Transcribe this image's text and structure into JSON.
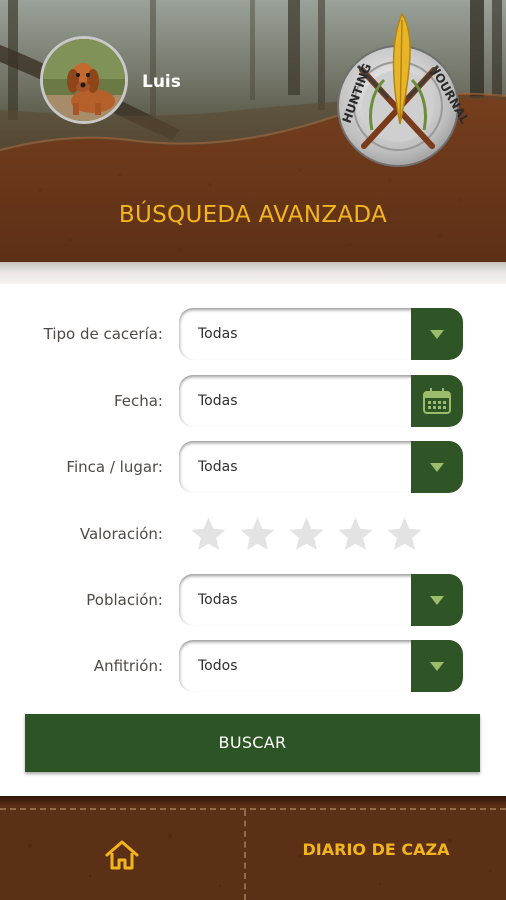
{
  "user": {
    "name": "Luis"
  },
  "logo": {
    "text_top": "HUNTING",
    "text_right": "JOURNAL"
  },
  "page": {
    "title": "BÚSQUEDA AVANZADA"
  },
  "form": {
    "hunt_type": {
      "label": "Tipo de cacería:",
      "value": "Todas"
    },
    "date": {
      "label": "Fecha:",
      "value": "Todas"
    },
    "estate": {
      "label": "Finca / lugar:",
      "value": "Todas"
    },
    "rating": {
      "label": "Valoración:",
      "value": 0,
      "max": 5
    },
    "town": {
      "label": "Población:",
      "value": "Todas"
    },
    "host": {
      "label": "Anfitrión:",
      "value": "Todos"
    },
    "search_label": "BUSCAR"
  },
  "footer": {
    "home_icon": "home-icon",
    "diary_label": "DIARIO DE CAZA"
  },
  "colors": {
    "accent_gold": "#f2b51d",
    "button_green": "#2d5424",
    "leather_brown": "#6b3a1e"
  }
}
